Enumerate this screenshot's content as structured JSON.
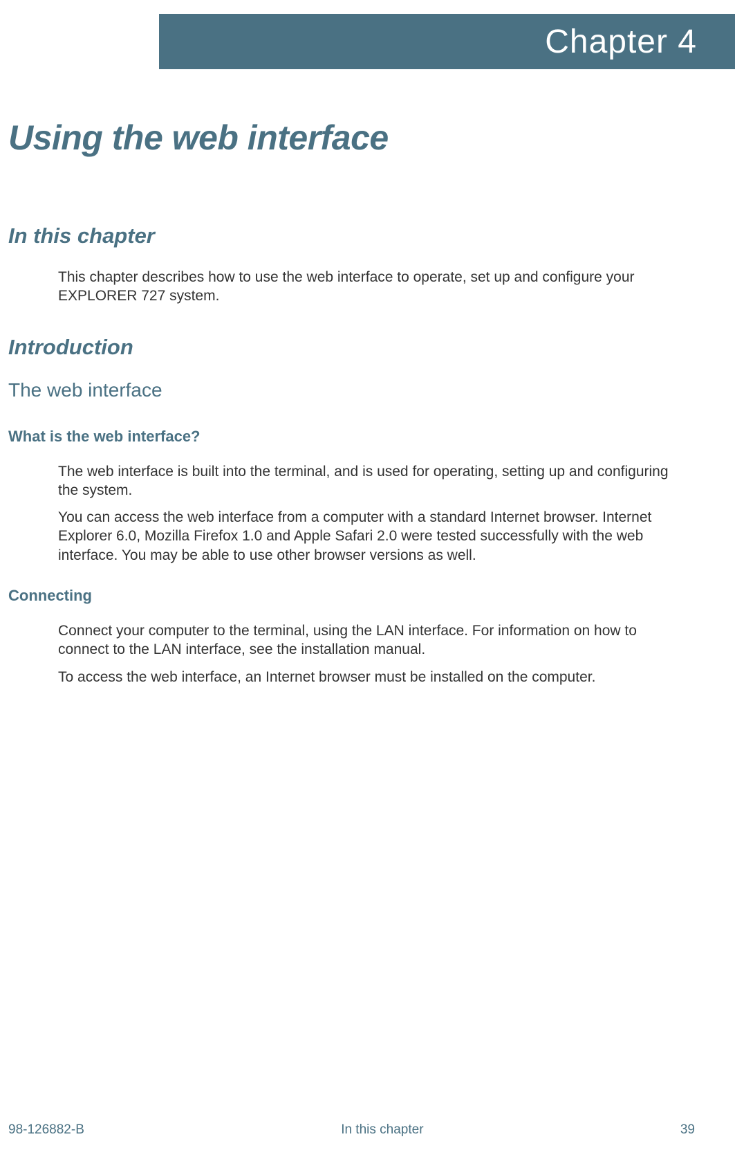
{
  "header": {
    "chapter_label": "Chapter 4"
  },
  "title": "Using the web interface",
  "section1": {
    "heading": "In this chapter",
    "para1": "This chapter describes how to use the web interface to operate, set up and configure your EXPLORER 727 system."
  },
  "section2": {
    "heading": "Introduction",
    "sub1": {
      "heading": "The web interface",
      "q1": {
        "heading": "What is the web interface?",
        "para1": "The web interface is built into the terminal, and is used for operating, setting up and configuring the system.",
        "para2": "You can access the web interface from a computer with a standard Internet browser. Internet Explorer 6.0, Mozilla Firefox 1.0 and Apple Safari 2.0 were tested successfully with the web interface. You may be able to use other browser versions as well."
      },
      "q2": {
        "heading": "Connecting",
        "para1": "Connect your computer to the terminal, using the LAN interface. For information on how to connect to the LAN interface, see the installation manual.",
        "para2": "To access the web interface, an Internet browser must be installed on the computer."
      }
    }
  },
  "footer": {
    "left": "98-126882-B",
    "center": "In this chapter",
    "right": "39"
  }
}
